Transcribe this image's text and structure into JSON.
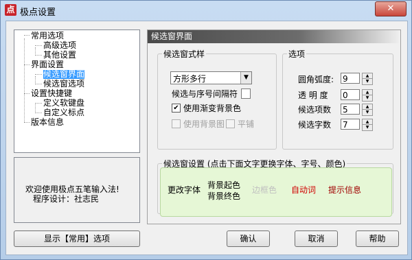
{
  "window": {
    "title": "极点设置",
    "icon_glyph": "点",
    "close_glyph": "✕"
  },
  "tree": {
    "items": [
      {
        "label": "常用选项",
        "level": 0
      },
      {
        "label": "高级选项",
        "level": 1
      },
      {
        "label": "其他设置",
        "level": 1
      },
      {
        "label": "界面设置",
        "level": 0
      },
      {
        "label": "候选窗界面",
        "level": 1,
        "selected": true
      },
      {
        "label": "候选窗选项",
        "level": 1
      },
      {
        "label": "设置快捷键",
        "level": 0
      },
      {
        "label": "定义软键盘",
        "level": 1
      },
      {
        "label": "自定义标点",
        "level": 1
      },
      {
        "label": "版本信息",
        "level": 0
      }
    ]
  },
  "welcome": {
    "line1": "欢迎使用极点五笔输入法!",
    "line2": "程序设计：社志民"
  },
  "buttons": {
    "show_common": "显示【常用】选项",
    "ok": "确认",
    "cancel": "取消",
    "help": "帮助"
  },
  "panel": {
    "title": "候选窗界面",
    "style_group": {
      "legend": "候选窗式样",
      "combo_value": "方形多行",
      "separator_label": "候选与序号间隔符",
      "gradient_bg": {
        "label": "使用渐变背景色",
        "checked": true
      },
      "bg_image": {
        "label": "使用背景图",
        "checked": false
      },
      "tile": {
        "label": "平铺",
        "checked": false
      }
    },
    "options_group": {
      "legend": "选项",
      "corner_radius": {
        "label": "圆角弧度:",
        "value": "9"
      },
      "transparency": {
        "label": "透 明 度",
        "value": "0"
      },
      "candidate_count": {
        "label": "候选项数",
        "value": "5"
      },
      "word_count": {
        "label": "候选字数",
        "value": "7"
      }
    },
    "window_group": {
      "legend": "候选窗设置 (点击下面文字更换字体、字号、颜色)",
      "change_font": "更改字体",
      "bg_start": "背景起色",
      "bg_end": "背景终色",
      "border_color": "边框色",
      "auto_word": "自动词",
      "hint_info": "提示信息"
    }
  },
  "colors": {
    "selected": "#3399ff",
    "auto_word": "#d00000",
    "hint_info": "#a00000",
    "border_color_text": "#c0c0c0",
    "sample_bg": "#e6f7d6"
  }
}
